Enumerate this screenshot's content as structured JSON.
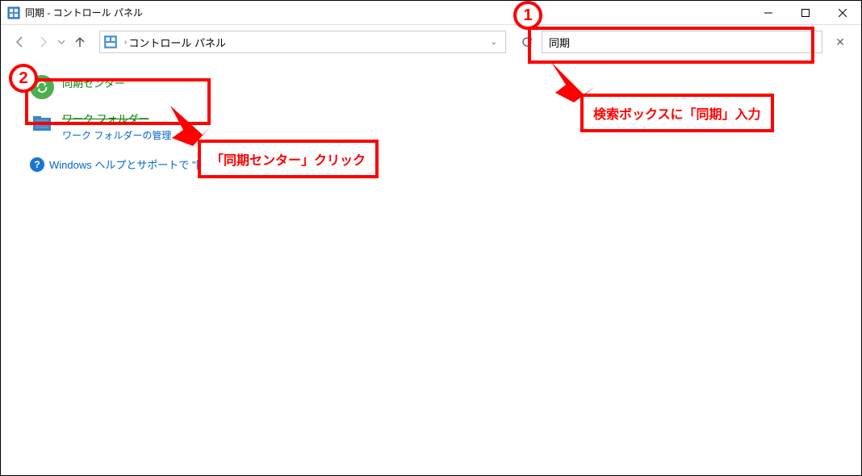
{
  "window": {
    "title": "同期 - コントロール パネル"
  },
  "address": {
    "location": "コントロール パネル"
  },
  "search": {
    "value": "同期"
  },
  "results": {
    "sync_center": {
      "title": "同期センター"
    },
    "work_folders": {
      "title_struck": "ワーク フォルダー",
      "sub": "ワーク フォルダーの管理"
    },
    "help": {
      "text": "Windows ヘルプとサポートで \"同期"
    }
  },
  "annotations": {
    "step1": "1",
    "step2": "2",
    "search_hint": "検索ボックスに「同期」入力",
    "click_hint": "「同期センター」クリック"
  }
}
